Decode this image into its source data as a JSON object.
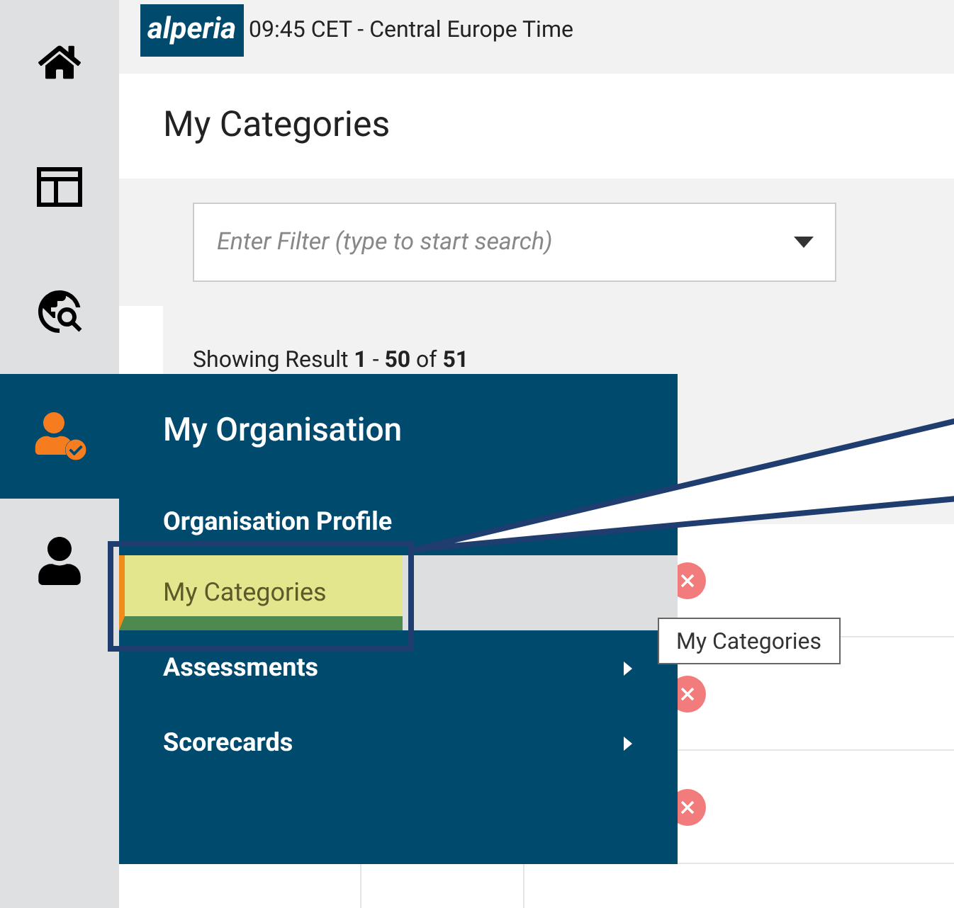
{
  "sidebar": {
    "items": [
      {
        "kind": "home",
        "selected": false
      },
      {
        "kind": "layout",
        "selected": false
      },
      {
        "kind": "globe-search",
        "selected": false
      },
      {
        "kind": "user-check",
        "selected": true
      },
      {
        "kind": "user",
        "selected": false
      }
    ]
  },
  "header": {
    "logo": "alperia",
    "time": "09:45 CET - Central Europe Time"
  },
  "page_title": "My Categories",
  "filter": {
    "placeholder": "Enter Filter (type to start search)"
  },
  "result_summary": "Showing Result **1** - **50** of **51**",
  "rows": [
    {
      "removable": true
    },
    {
      "removable": true
    },
    {
      "removable": true
    },
    {
      "removable": false
    }
  ],
  "flyout": {
    "title": "My Organisation",
    "items": [
      {
        "label": "Organisation Profile",
        "selected": false,
        "submenu": false,
        "callout": false
      },
      {
        "label": "My Categories",
        "selected": true,
        "submenu": false,
        "callout": true
      },
      {
        "label": "Assessments",
        "selected": false,
        "submenu": true,
        "callout": false
      },
      {
        "label": "Scorecards",
        "selected": false,
        "submenu": true,
        "callout": false
      }
    ]
  },
  "tooltip": "My Categories"
}
